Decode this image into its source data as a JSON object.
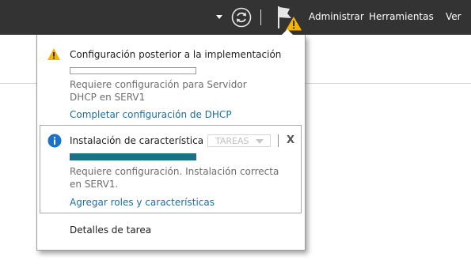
{
  "topbar": {
    "menu": [
      "Administrar",
      "Herramientas",
      "Ver"
    ],
    "icons": [
      "dropdown-caret-icon",
      "refresh-icon",
      "notification-flag-icon",
      "warning-icon"
    ]
  },
  "notifications": {
    "items": [
      {
        "icon": "warning-icon",
        "title": "Configuración posterior a la implementación",
        "progress": 0,
        "description": "Requiere configuración para Servidor DHCP en SERV1",
        "link": "Completar configuración de DHCP"
      },
      {
        "icon": "info-icon",
        "title": "Instalación de característica",
        "progress": 1.0,
        "tasks_label": "TAREAS",
        "dismiss_label": "X",
        "description": "Requiere configuración. Instalación correcta en SERV1.",
        "link": "Agregar roles y características"
      }
    ],
    "footer_link": "Detalles de tarea"
  },
  "colors": {
    "topbar_bg": "#333333",
    "link": "#1e6e9c",
    "progress_fill": "#1b6f86",
    "warning": "#f5b400",
    "info": "#1a73c8"
  }
}
